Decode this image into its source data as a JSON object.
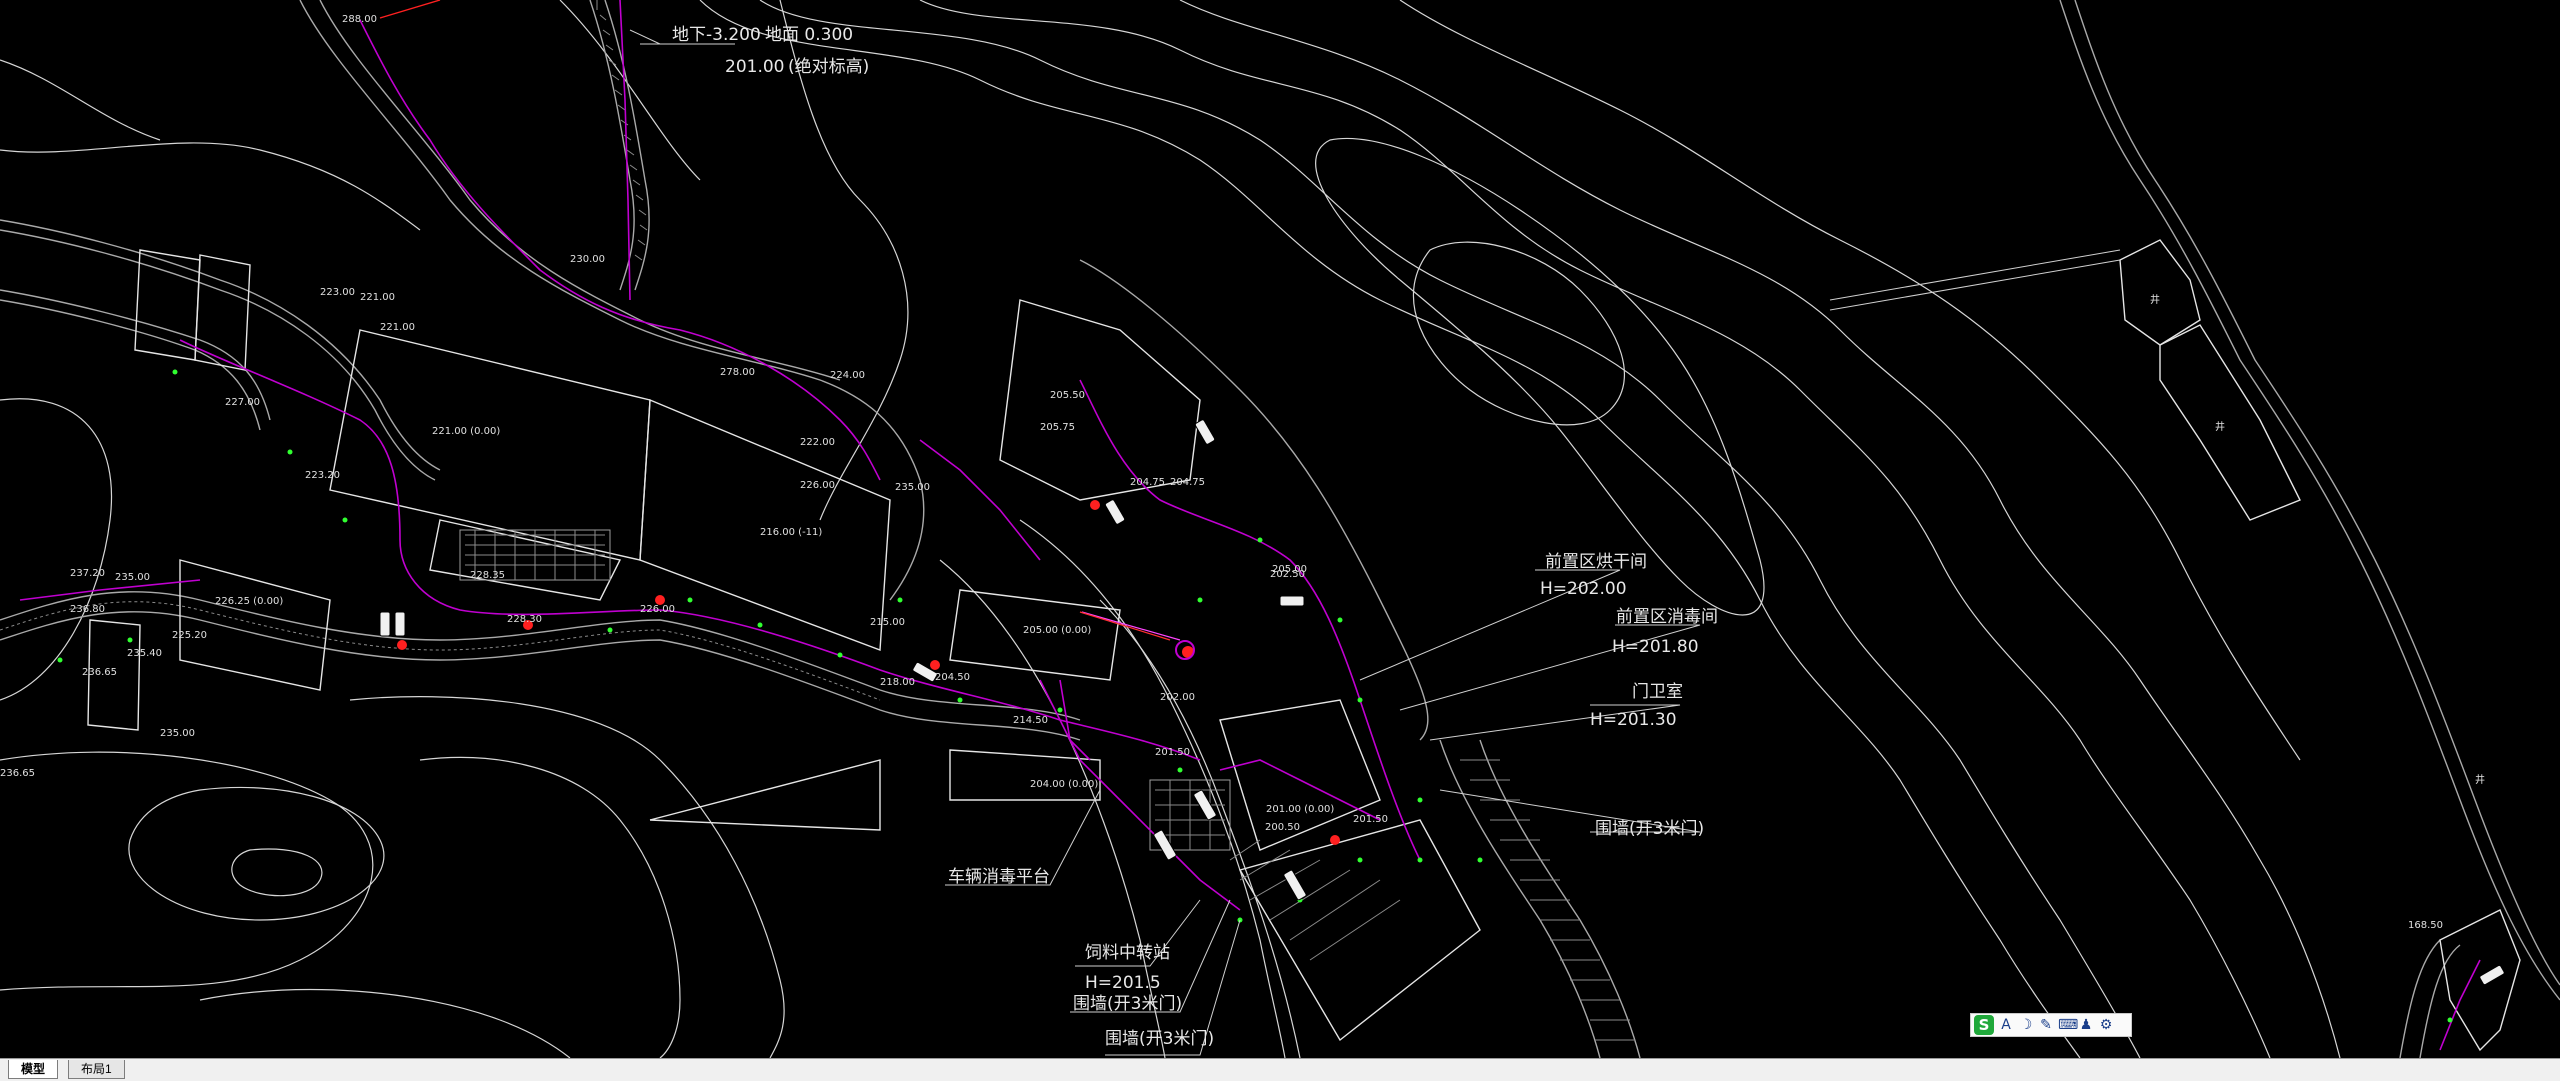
{
  "drawing": {
    "labels": {
      "underground": "地下-3.200",
      "ground": "地面 0.300",
      "absolute_elev": "201.00",
      "absolute_note": "(绝对标高)",
      "dryer_room": "前置区烘干间",
      "dryer_h": "H=202.00",
      "disinfect_room": "前置区消毒间",
      "disinfect_h": "H=201.80",
      "guard_room": "门卫室",
      "guard_h": "H=201.30",
      "wall_gate_1": "围墙(开3米门)",
      "vehicle_platform": "车辆消毒平台",
      "feed_station": "饲料中转站",
      "feed_h": "H=201.5",
      "wall_gate_2": "围墙(开3米门)",
      "wall_gate_3": "围墙(开3米门)"
    },
    "elevations": [
      "288.00",
      "278.00",
      "221.00",
      "222.00",
      "227.00",
      "230.00",
      "226.00",
      "235.00",
      "221.00",
      "223.00",
      "221.00 (0.00)",
      "223.20",
      "235.00",
      "237.20",
      "225.20",
      "226.25 (0.00)",
      "235.40",
      "236.80",
      "236.65",
      "235.00",
      "228.35",
      "228.30",
      "226.00",
      "216.00 (-11)",
      "218.00",
      "215.00",
      "214.50",
      "205.00 (0.00)",
      "205.00",
      "204.75",
      "204.00 (0.00)",
      "204.50",
      "202.00",
      "201.50",
      "201.50",
      "201.00 (0.00)",
      "200.50",
      "205.50",
      "205.75",
      "204.75",
      "202.50",
      "224.00",
      "236.65",
      "168.50"
    ],
    "colors": {
      "background": "#000000",
      "contour": "#d6d6d6",
      "pipe": "#c000d0",
      "marker": "#ff2020",
      "node": "#30ff30"
    }
  },
  "tabs": {
    "model": "模型",
    "layout1": "布局1"
  },
  "ime": {
    "logo": "S",
    "items": [
      "A",
      "☽",
      "✎",
      "⌨",
      "♟",
      "⚙"
    ]
  }
}
